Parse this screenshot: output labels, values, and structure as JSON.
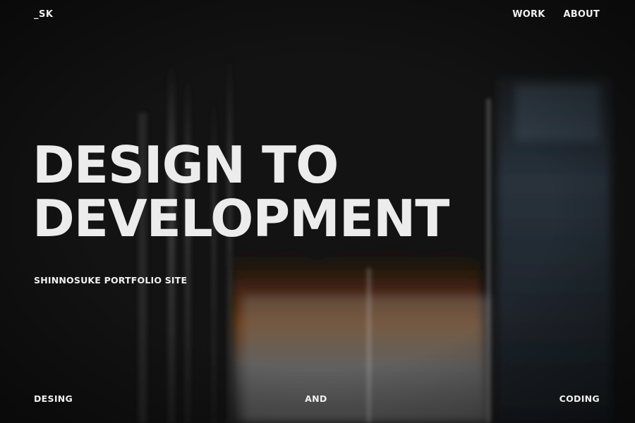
{
  "header": {
    "logo": "_SK",
    "nav": [
      {
        "label": "WORK"
      },
      {
        "label": "ABOUT"
      }
    ]
  },
  "hero": {
    "headline_line1": "DESIGN TO",
    "headline_line2": "DEVELOPMENT",
    "subtitle": "SHINNOSUKE PORTFOLIO SITE"
  },
  "footer": {
    "left": "DESING",
    "center": "AND",
    "right": "CODING"
  },
  "colors": {
    "background": "#111111",
    "text": "#ececec",
    "accent_glow": "#c8641e"
  }
}
